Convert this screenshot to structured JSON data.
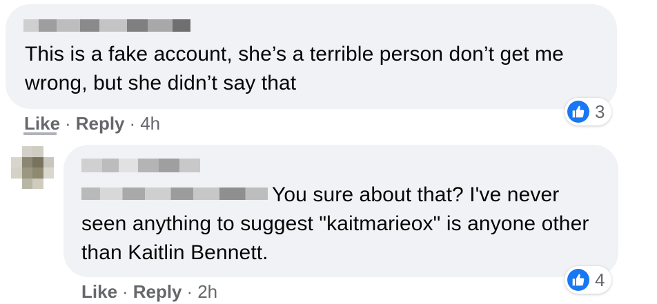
{
  "comments": [
    {
      "text": "This is a fake account, she’s a terrible person don’t get me wrong, but she didn’t say that",
      "like_label": "Like",
      "reply_label": "Reply",
      "separator": "·",
      "time": "4h",
      "reaction_count": "3"
    },
    {
      "text": "You sure about that? I've never seen anything to suggest \"kaitmarieox\" is anyone other than Kaitlin Bennett.",
      "like_label": "Like",
      "reply_label": "Reply",
      "separator": "·",
      "time": "2h",
      "reaction_count": "4"
    }
  ],
  "colors": {
    "bubble": "#f0f2f5",
    "secondary_text": "#65676b",
    "like_blue": "#1877f2"
  },
  "icons": [
    "like-reaction-icon",
    "avatar"
  ]
}
